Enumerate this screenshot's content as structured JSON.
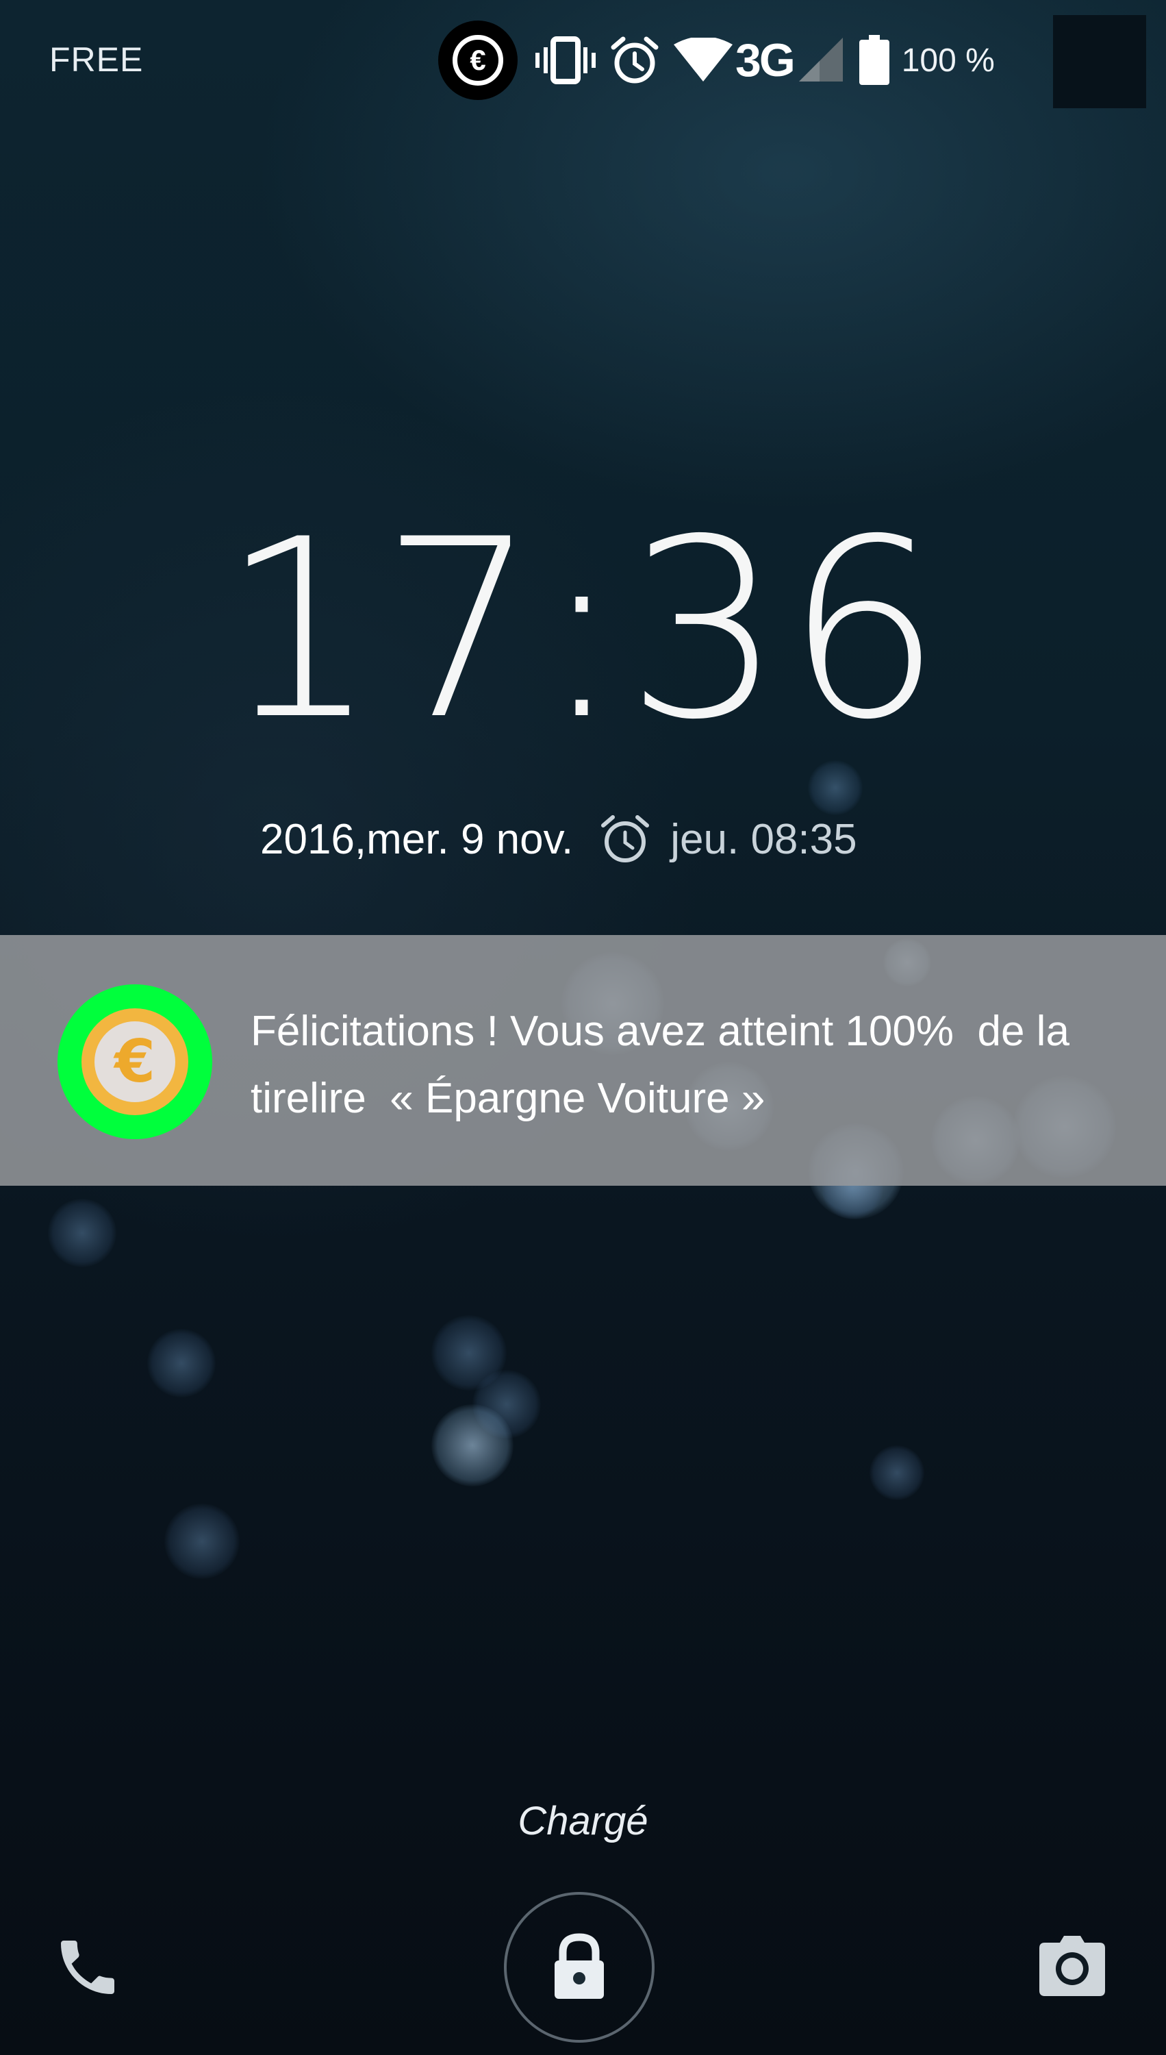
{
  "status_bar": {
    "carrier": "FREE",
    "network_type": "3G",
    "battery_percent": "100 %",
    "icons": [
      "euro-app-icon",
      "vibrate-icon",
      "alarm-icon",
      "wifi-icon",
      "signal-icon",
      "battery-icon"
    ]
  },
  "lockscreen": {
    "time": "17:36",
    "date": "2016,mer. 9 nov.",
    "next_alarm": "jeu. 08:35"
  },
  "notification": {
    "text": "Félicitations ! Vous avez atteint 100%  de la\ntirelire  « Épargne Voiture »",
    "icon": "euro-coin-icon",
    "icon_ring_color": "#00ff3c"
  },
  "bottom": {
    "charging_status": "Chargé",
    "icons": [
      "phone-icon",
      "lock-icon",
      "camera-icon"
    ]
  }
}
